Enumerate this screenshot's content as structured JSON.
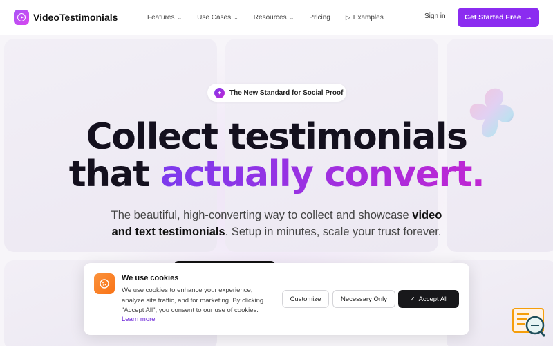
{
  "nav": {
    "brand": "VideoTestimonials",
    "links": [
      {
        "label": "Features",
        "has_dropdown": true
      },
      {
        "label": "Use Cases",
        "has_dropdown": true
      },
      {
        "label": "Resources",
        "has_dropdown": true
      },
      {
        "label": "Pricing",
        "has_dropdown": false
      },
      {
        "label": "Examples",
        "has_dropdown": false
      }
    ],
    "sign_in": "Sign in",
    "cta": "Get Started Free"
  },
  "hero": {
    "badge": "The New Standard for Social Proof",
    "headline_line1": "Collect testimonials",
    "headline_line2_plain": "that ",
    "headline_line2_accent": "actually convert.",
    "sub_part1": "The beautiful, high-converting way to collect and showcase ",
    "sub_bold1": "video",
    "sub_bold2": "and text testimonials",
    "sub_part2": ". Setup in minutes, scale your trust forever."
  },
  "cookie": {
    "title": "We use cookies",
    "body": "We use cookies to enhance your experience, analyze site traffic, and for marketing. By clicking \"Accept All\", you consent to our use of cookies.",
    "link": "Learn more",
    "customize": "Customize",
    "necessary": "Necessary Only",
    "accept": "Accept All"
  },
  "colors": {
    "brand_purple": "#8b2cf0",
    "gradient_start": "#7c3aed",
    "gradient_end": "#c026d3",
    "cookie_icon": "#f97316"
  }
}
